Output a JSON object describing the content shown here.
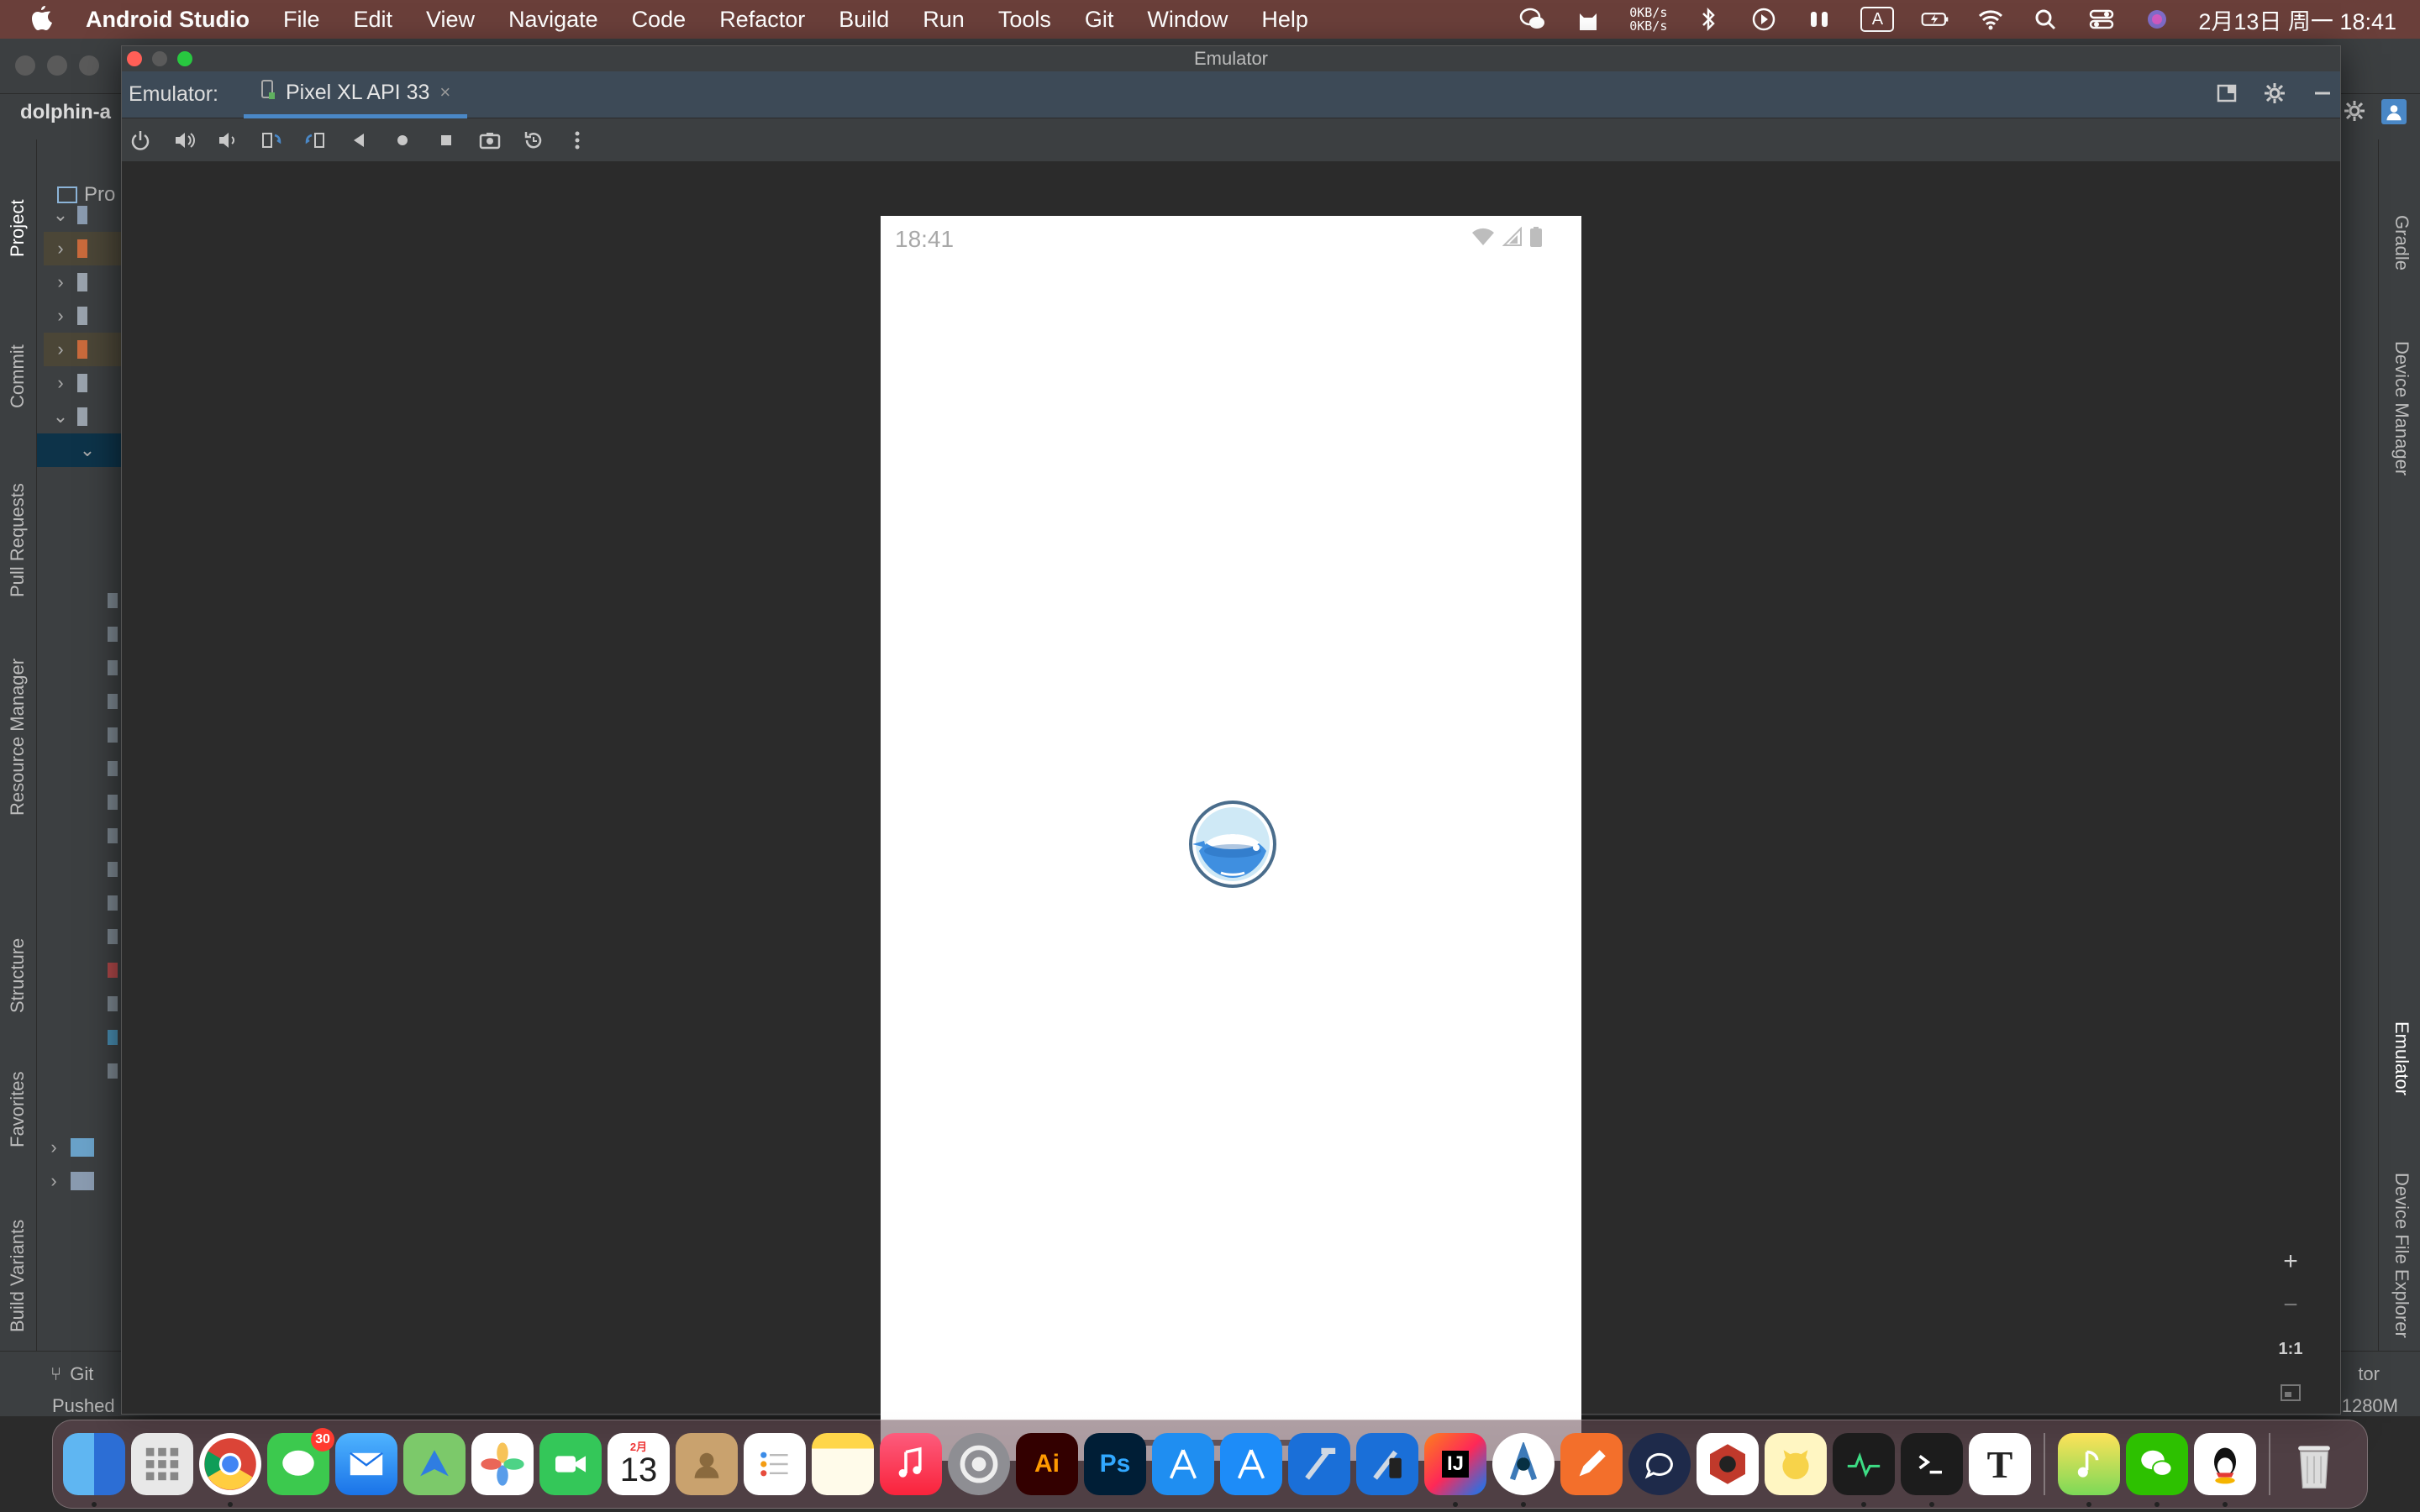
{
  "menubar": {
    "app_name": "Android Studio",
    "items": [
      "File",
      "Edit",
      "View",
      "Navigate",
      "Code",
      "Refactor",
      "Build",
      "Run",
      "Tools",
      "Git",
      "Window",
      "Help"
    ],
    "net_up": "0KB/s",
    "net_down": "0KB/s",
    "ime": "A",
    "clock": "2月13日 周一  18:41"
  },
  "ide": {
    "project_name": "dolphin-a",
    "project_tab": "Pro",
    "left_tabs": [
      "Project",
      "Commit",
      "Pull Requests",
      "Resource Manager",
      "Structure",
      "Favorites",
      "Build Variants"
    ],
    "right_tabs": [
      "Gradle",
      "Device Manager",
      "Emulator",
      "Device File Explorer"
    ],
    "git_tab": "Git",
    "status_text": "Pushed",
    "memory": "1280M",
    "right_tool_label": "tor"
  },
  "emulator": {
    "window_title": "Emulator",
    "label": "Emulator:",
    "tab_name": "Pixel XL API 33",
    "toolbar": [
      "power",
      "volume-up",
      "volume-down",
      "rotate-left",
      "rotate-right",
      "back",
      "home",
      "overview",
      "screenshot",
      "snapshot",
      "more"
    ],
    "zoom": {
      "zoom_in": "+",
      "zoom_out": "−",
      "actual_size": "1:1"
    }
  },
  "phone": {
    "status_time": "18:41"
  },
  "dock": {
    "messages_badge": "30",
    "calendar_month": "2月",
    "calendar_day": "13",
    "apps": [
      "Finder",
      "Launchpad",
      "Chrome",
      "Messages",
      "Mail",
      "Maps",
      "Photos",
      "FaceTime",
      "Calendar",
      "Contacts",
      "Reminders",
      "Notes",
      "Music",
      "System Preferences",
      "Illustrator",
      "Photoshop",
      "Xcode Instruments",
      "App Store",
      "Xcode",
      "Simulator",
      "IntelliJ IDEA",
      "Android Studio",
      "Pencil",
      "ChatGPT",
      "Jisu",
      "Navicat",
      "Activity Monitor",
      "Terminal",
      "Typora",
      "QQ Music",
      "WeChat",
      "QQ",
      "Trash"
    ],
    "labels": {
      "illustrator": "Ai",
      "photoshop": "Ps",
      "typora": "T",
      "intellij": "IJ"
    }
  }
}
